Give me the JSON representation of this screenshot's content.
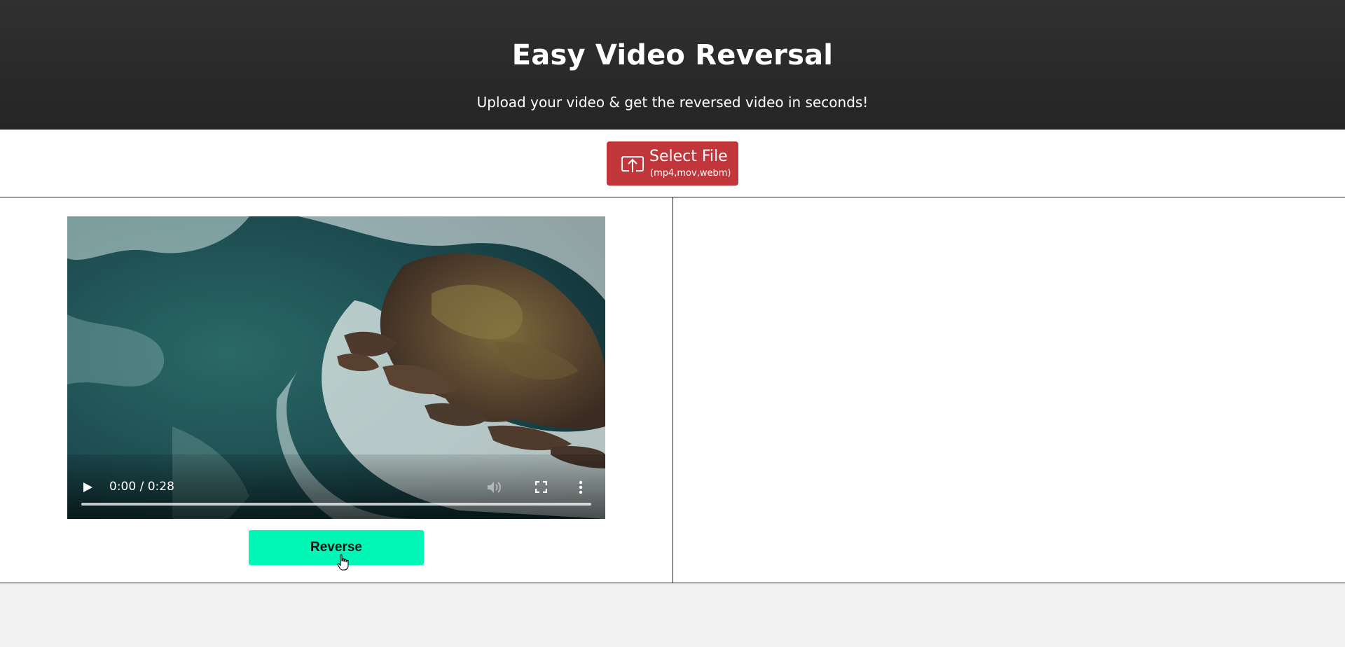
{
  "header": {
    "title": "Easy Video Reversal",
    "subtitle": "Upload your video & get the reversed video in seconds!"
  },
  "upload": {
    "button_label": "Select File",
    "button_sublabel": "(mp4,mov,webm)",
    "icon": "upload-icon"
  },
  "video": {
    "current_time": "0:00",
    "duration": "0:28",
    "time_display": "0:00 / 0:28",
    "progress_fraction": 0,
    "controls": [
      "play-icon",
      "mute-icon",
      "fullscreen-icon",
      "more-icon"
    ]
  },
  "actions": {
    "reverse_label": "Reverse"
  },
  "colors": {
    "header_bg": "#2b2b2b",
    "select_file_bg": "#c0363b",
    "reverse_bg": "#00f7b5",
    "page_bg": "#f2f2f2"
  }
}
